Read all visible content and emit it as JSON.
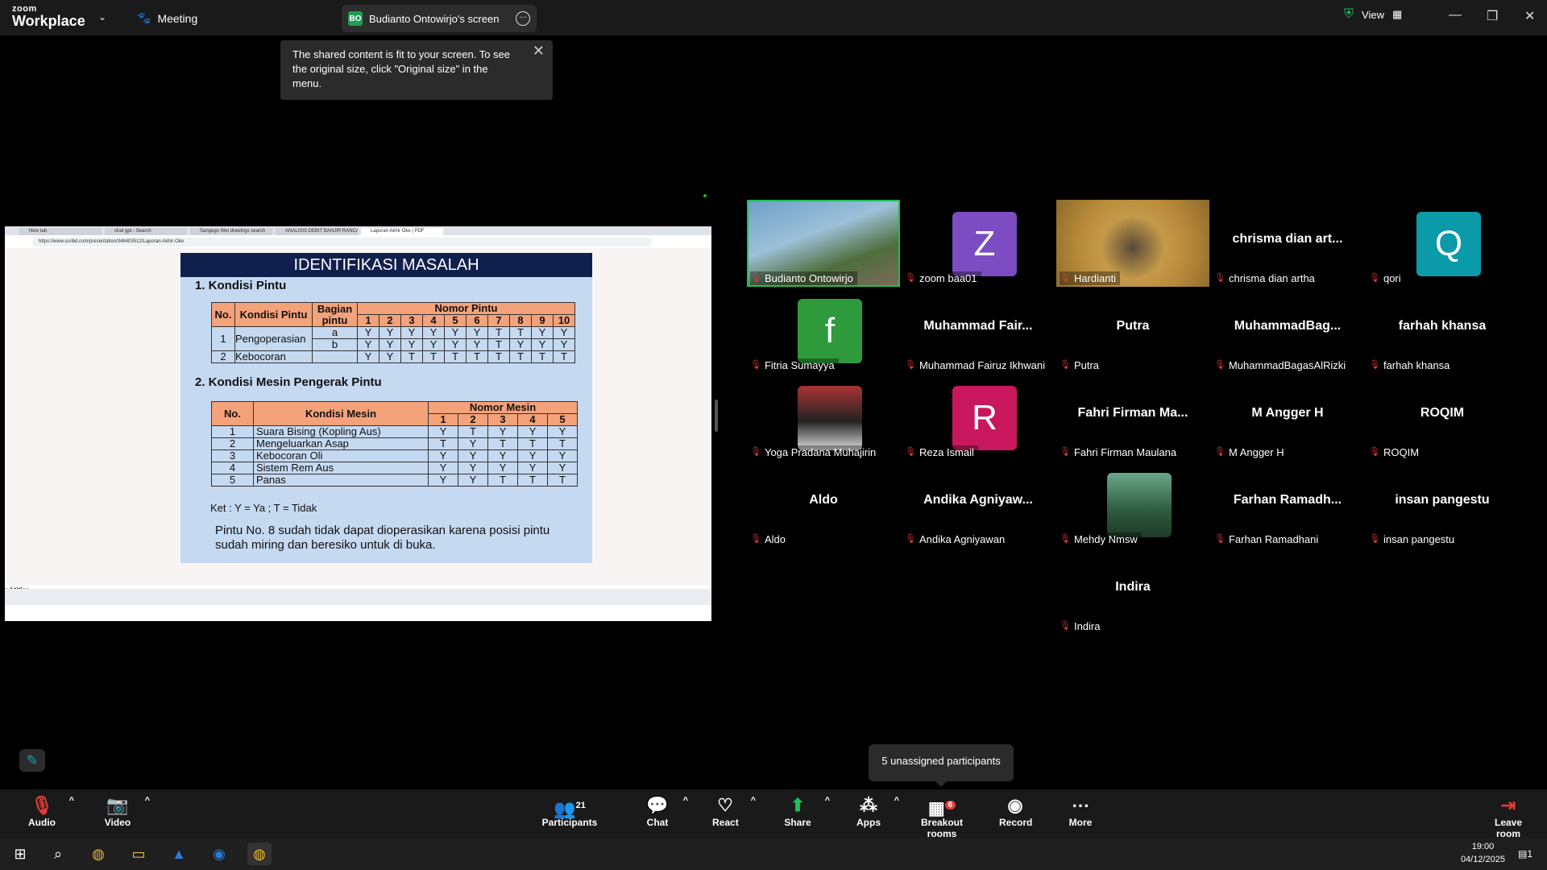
{
  "app": {
    "brand_top": "zoom",
    "brand_bottom": "Workplace",
    "meeting_label": "Meeting",
    "share_badge": "BO",
    "share_tab_label": "Budianto Ontowirjo's screen",
    "view_label": "View"
  },
  "tooltip": {
    "text": "The shared content is fit to your screen. To see the original size, click \"Original size\" in the menu."
  },
  "shared": {
    "browser_tabs": [
      "New tab",
      "chat gpt - Search",
      "Sangego Wei drawings search",
      "ANALISIS DEBIT BANJIR RANCA",
      "Laporan Akhir Oke | PDF"
    ],
    "url": "https://www.scribd.com/presentation/348403512/Laporan-Akhir-Oke",
    "slide_title": "IDENTIFIKASI MASALAH",
    "section1": "1. Kondisi Pintu",
    "section2": "2. Kondisi Mesin Pengerak Pintu",
    "t1": {
      "h_no": "No.",
      "h_kondisi": "Kondisi Pintu",
      "h_bagian": "Bagian pintu",
      "h_nomor": "Nomor Pintu",
      "row1_no": "1",
      "row1_name": "Pengoperasian",
      "row1a_part": "a",
      "row1b_part": "b",
      "row2_no": "2",
      "row2_name": "Kebocoran"
    },
    "t2": {
      "h_no": "No.",
      "h_kondisi": "Kondisi Mesin",
      "h_nomor": "Nomor Mesin"
    },
    "ket": "Ket : Y = Ya ;  T = Tidak",
    "note": "Pintu No. 8 sudah tidak dapat dioperasikan karena posisi pintu sudah miring dan beresiko untuk di buka.",
    "caption": "ed titles"
  },
  "participants": [
    {
      "label": "Budianto Ontowirjo",
      "display": "",
      "avatar": "video"
    },
    {
      "label": "zoom baa01",
      "display": "",
      "avatar": "Z",
      "color": "#7b4cc2"
    },
    {
      "label": "Hardianti",
      "display": "",
      "avatar": "video2"
    },
    {
      "label": "chrisma dian artha",
      "display": "chrisma dian art...",
      "avatar": ""
    },
    {
      "label": "qori",
      "display": "",
      "avatar": "Q",
      "color": "#0b9aa8"
    },
    {
      "label": "Fitria Sumayya",
      "display": "",
      "avatar": "f",
      "color": "#2e9a3c"
    },
    {
      "label": "Muhammad Fairuz Ikhwani",
      "display": "Muhammad Fair...",
      "avatar": ""
    },
    {
      "label": "Putra",
      "display": "Putra",
      "avatar": ""
    },
    {
      "label": "MuhammadBagasAlRizki",
      "display": "MuhammadBag...",
      "avatar": ""
    },
    {
      "label": "farhah khansa",
      "display": "farhah khansa",
      "avatar": ""
    },
    {
      "label": "Yoga Pradana Muhajirin",
      "display": "",
      "avatar": "photo"
    },
    {
      "label": "Reza Ismail",
      "display": "",
      "avatar": "R",
      "color": "#c8175c"
    },
    {
      "label": "Fahri Firman Maulana",
      "display": "Fahri Firman Ma...",
      "avatar": ""
    },
    {
      "label": "M Angger H",
      "display": "M Angger H",
      "avatar": ""
    },
    {
      "label": "ROQIM",
      "display": "ROQIM",
      "avatar": ""
    },
    {
      "label": "Aldo",
      "display": "Aldo",
      "avatar": ""
    },
    {
      "label": "Andika Agniyawan",
      "display": "Andika Agniyaw...",
      "avatar": ""
    },
    {
      "label": "Mehdy Nmsw",
      "display": "",
      "avatar": "photo2"
    },
    {
      "label": "Farhan Ramadhani",
      "display": "Farhan Ramadh...",
      "avatar": ""
    },
    {
      "label": "insan pangestu",
      "display": "insan pangestu",
      "avatar": ""
    },
    {
      "label": "Indira",
      "display": "Indira",
      "avatar": ""
    }
  ],
  "unassigned": "5 unassigned participants",
  "toolbar": {
    "audio": "Audio",
    "video": "Video",
    "participants": "Participants",
    "participants_count": "21",
    "chat": "Chat",
    "react": "React",
    "share": "Share",
    "apps": "Apps",
    "breakout": "Breakout rooms",
    "breakout_badge": "6",
    "record": "Record",
    "more": "More",
    "leave": "Leave room"
  },
  "taskbar": {
    "time": "19:00",
    "date": "04/12/2025",
    "notif": "1"
  }
}
